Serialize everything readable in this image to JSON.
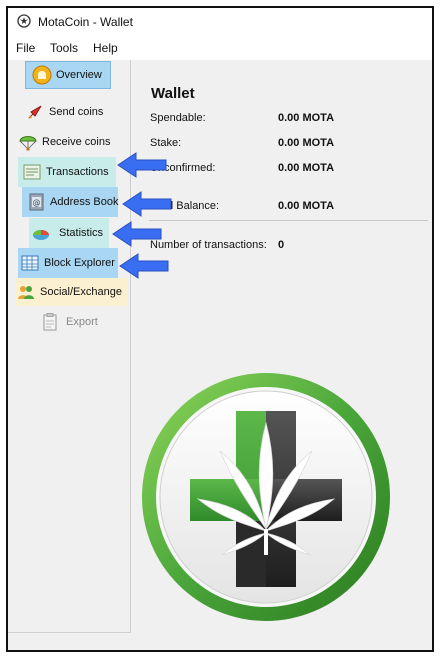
{
  "window": {
    "title": "MotaCoin - Wallet",
    "app_icon": "motacoin-logo-icon"
  },
  "menu": [
    "File",
    "Tools",
    "Help"
  ],
  "sidebar": {
    "items": [
      {
        "label": "Overview",
        "icon": "overview-icon"
      },
      {
        "label": "Send coins",
        "icon": "rocket-icon"
      },
      {
        "label": "Receive coins",
        "icon": "parachute-icon"
      },
      {
        "label": "Transactions",
        "icon": "transactions-icon"
      },
      {
        "label": "Address Book",
        "icon": "address-book-icon"
      },
      {
        "label": "Statistics",
        "icon": "pie-chart-icon"
      },
      {
        "label": "Block Explorer",
        "icon": "block-explorer-icon"
      },
      {
        "label": "Social/Exchange",
        "icon": "people-icon"
      },
      {
        "label": "Export",
        "icon": "export-icon"
      }
    ]
  },
  "wallet": {
    "title": "Wallet",
    "spendable_label": "Spendable:",
    "spendable_value": "0.00 MOTA",
    "stake_label": "Stake:",
    "stake_value": "0.00 MOTA",
    "unconfirmed_label": "Unconfirmed:",
    "unconfirmed_value": "0.00 MOTA",
    "total_label": "Total Balance:",
    "total_value": "0.00 MOTA",
    "transactions_label": "Number of transactions:",
    "transactions_value": "0"
  },
  "colors": {
    "highlight": "#a9d6f2",
    "arrow": "#3a6ef2",
    "logo_green": "#4aa63a"
  }
}
